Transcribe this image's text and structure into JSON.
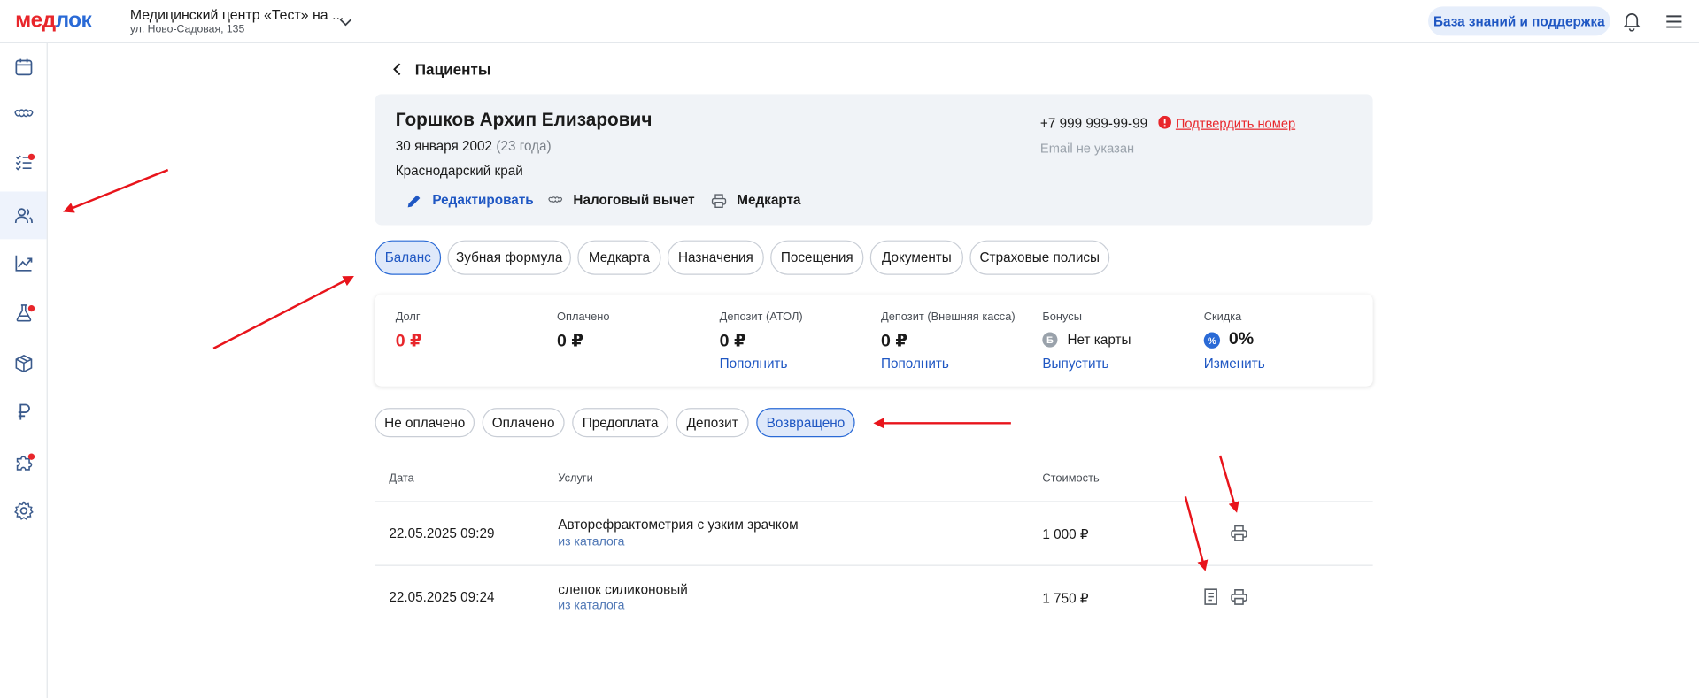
{
  "header": {
    "logo_part1": "мед",
    "logo_part2": "лок",
    "clinic_name": "Медицинский центр «Тест» на ...",
    "clinic_address": "ул. Ново-Садовая, 135",
    "help_label": "База знаний и поддержка"
  },
  "sidebar": {
    "items": [
      {
        "icon": "calendar-icon"
      },
      {
        "icon": "tooth-icon"
      },
      {
        "icon": "task-list-icon",
        "badge": true
      },
      {
        "icon": "patients-icon",
        "active": true
      },
      {
        "icon": "analytics-chart-icon"
      },
      {
        "icon": "lab-flask-icon",
        "badge": true
      },
      {
        "icon": "box-icon"
      },
      {
        "icon": "ruble-icon"
      },
      {
        "icon": "puzzle-icon",
        "badge": true
      },
      {
        "icon": "settings-gear-icon"
      }
    ]
  },
  "page": {
    "back_label": "Пациенты"
  },
  "patient": {
    "name": "Горшков Архип Елизарович",
    "dob": "30 января 2002",
    "age": "(23 года)",
    "region": "Краснодарский край",
    "phone": "+7 999 999-99-99",
    "confirm_label": "Подтвердить номер",
    "email": "Email не указан",
    "actions": {
      "edit": "Редактировать",
      "tax": "Налоговый вычет",
      "medcard": "Медкарта"
    }
  },
  "tabs": [
    "Баланс",
    "Зубная формула",
    "Медкарта",
    "Назначения",
    "Посещения",
    "Документы",
    "Страховые полисы"
  ],
  "active_tab": "Баланс",
  "balance": {
    "debt": {
      "label": "Долг",
      "value": "0 ₽"
    },
    "paid": {
      "label": "Оплачено",
      "value": "0 ₽"
    },
    "deposit_atol": {
      "label": "Депозит (АТОЛ)",
      "value": "0 ₽",
      "action": "Пополнить"
    },
    "deposit_ext": {
      "label": "Депозит (Внешняя касса)",
      "value": "0 ₽",
      "action": "Пополнить"
    },
    "bonuses": {
      "label": "Бонусы",
      "badge": "Б",
      "value": "Нет карты",
      "action": "Выпустить"
    },
    "discount": {
      "label": "Скидка",
      "badge": "%",
      "value": "0%",
      "action": "Изменить"
    }
  },
  "filters": [
    "Не оплачено",
    "Оплачено",
    "Предоплата",
    "Депозит",
    "Возвращено"
  ],
  "active_filter": "Возвращено",
  "table": {
    "columns": {
      "date": "Дата",
      "services": "Услуги",
      "cost": "Стоимость"
    },
    "rows": [
      {
        "date": "22.05.2025 09:29",
        "service": "Авторефрактометрия с узким зрачком",
        "source": "из каталога",
        "cost": "1 000 ₽"
      },
      {
        "date": "22.05.2025 09:24",
        "service": "слепок силиконовый",
        "source": "из каталога",
        "cost": "1 750 ₽"
      }
    ]
  },
  "colors": {
    "brand_red": "#e8262b",
    "brand_blue": "#2a6ad6",
    "link": "#1f57c3",
    "annotation_arrow": "#e8141b"
  }
}
